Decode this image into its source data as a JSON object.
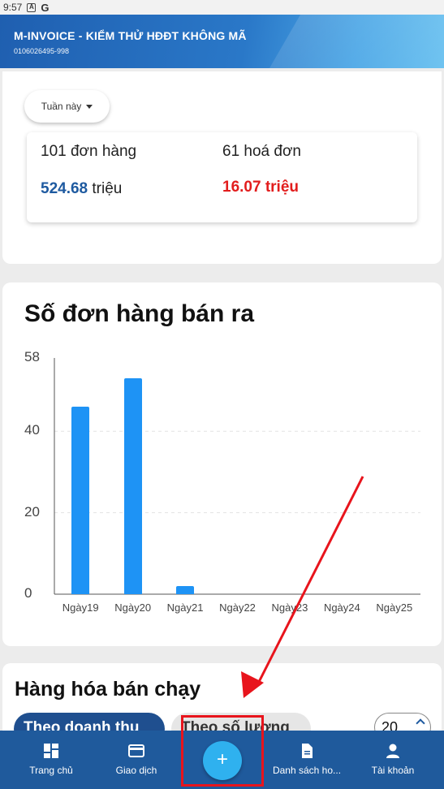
{
  "status_bar": {
    "time": "9:57",
    "icons": [
      "A",
      "G"
    ]
  },
  "header": {
    "title": "M-INVOICE - KIỂM THỬ HĐĐT KHÔNG MÃ",
    "tax_code": "0106026495-998"
  },
  "filter": {
    "selected": "Tuần này"
  },
  "stats": {
    "orders": "101 đơn hàng",
    "invoices": "61 hoá đơn",
    "orders_value_number": "524.68",
    "orders_value_unit": " triệu",
    "invoices_value": "16.07 triệu"
  },
  "chart_section": {
    "title": "Số đơn hàng bán ra"
  },
  "chart_data": {
    "type": "bar",
    "categories": [
      "Ngày19",
      "Ngày20",
      "Ngày21",
      "Ngày22",
      "Ngày23",
      "Ngày24",
      "Ngày25"
    ],
    "series": [
      {
        "values": [
          46,
          53,
          2,
          0,
          0,
          0,
          0
        ]
      }
    ],
    "yticks": [
      "58",
      "40",
      "20",
      "0"
    ],
    "ylim": [
      0,
      58
    ],
    "grid": true,
    "colors": {
      "bar": "#1e93f5"
    }
  },
  "products_section": {
    "title": "Hàng hóa bán chạy",
    "tabs": [
      {
        "label": "Theo doanh thu",
        "active": true
      },
      {
        "label": "Theo số lượng",
        "active": false
      }
    ],
    "count": "20"
  },
  "bottom_nav": {
    "items": [
      {
        "label": "Trang chủ",
        "icon": "dashboard-icon"
      },
      {
        "label": "Giao dịch",
        "icon": "card-icon"
      },
      {
        "label": "Danh sách ho...",
        "icon": "document-icon"
      },
      {
        "label": "Tài khoản",
        "icon": "person-icon"
      }
    ],
    "fab_symbol": "+"
  },
  "annotation": {
    "color": "#e8141c"
  }
}
